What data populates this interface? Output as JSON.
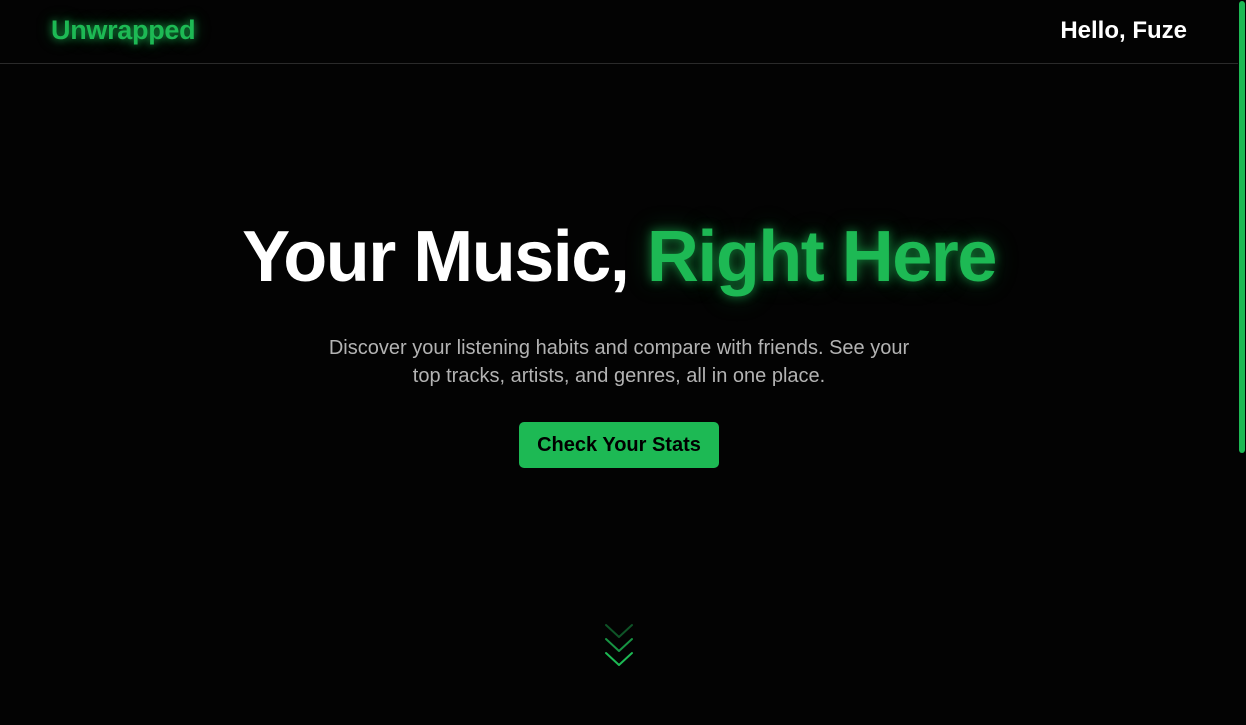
{
  "navbar": {
    "logo": "Unwrapped",
    "greeting": "Hello, Fuze"
  },
  "hero": {
    "headline_plain": "Your Music, ",
    "headline_accent": "Right Here",
    "subtitle": "Discover your listening habits and compare with friends. See your top tracks, artists, and genres, all in one place.",
    "cta_label": "Check Your Stats",
    "scroll_icon": "double-chevron-down-icon"
  },
  "colors": {
    "background": "#030303",
    "accent": "#1db954",
    "text_primary": "#ffffff",
    "text_secondary": "#b3b3b3",
    "divider": "#2a2a2a"
  },
  "scrollbar": {
    "position_fraction": 0.0,
    "visible_fraction": 0.62
  }
}
